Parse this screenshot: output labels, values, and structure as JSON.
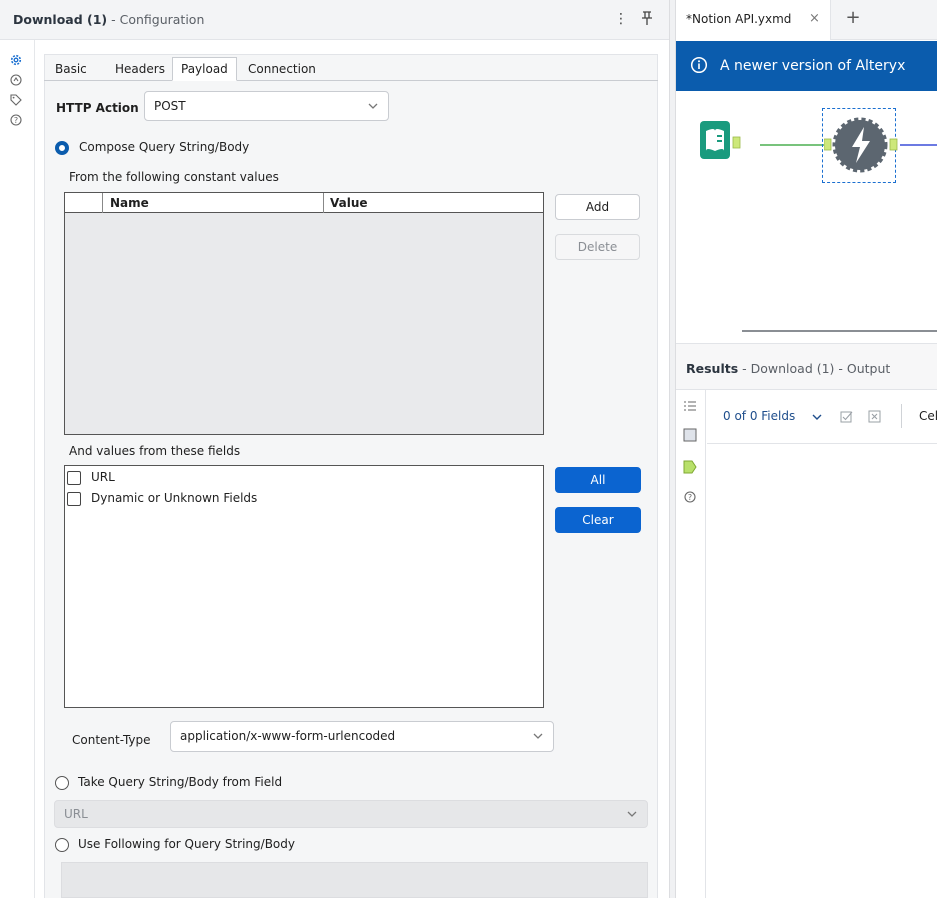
{
  "config_panel": {
    "title_bold": "Download (1)",
    "title_rest": " - Configuration",
    "tabs": [
      {
        "label": "Basic",
        "active": false
      },
      {
        "label": "Headers",
        "active": false
      },
      {
        "label": "Payload",
        "active": true
      },
      {
        "label": "Connection",
        "active": false
      }
    ],
    "http_action_label": "HTTP Action",
    "http_action_value": "POST",
    "compose_option_label": "Compose Query String/Body",
    "constant_values_label": "From the following constant values",
    "constant_grid": {
      "columns": [
        "Name",
        "Value"
      ],
      "rows": []
    },
    "add_button": "Add",
    "delete_button": "Delete",
    "fields_label": "And values from these fields",
    "fields": [
      {
        "label": "URL",
        "checked": false
      },
      {
        "label": "Dynamic or Unknown Fields",
        "checked": false
      }
    ],
    "all_button": "All",
    "clear_button": "Clear",
    "content_type_label": "Content-Type",
    "content_type_value": "application/x-www-form-urlencoded",
    "take_from_field_label": "Take Query String/Body from Field",
    "take_from_field_value": "URL",
    "use_following_label": "Use Following for Query String/Body"
  },
  "workspace": {
    "file_tab_label": "*Notion API.yxmd",
    "file_tab_close": "×",
    "new_tab": "+",
    "banner_text": "A newer version of Alteryx",
    "colors": {
      "banner": "#0b5cad",
      "accent_blue": "#0b64d0",
      "connector_green": "#4caf50",
      "connector_blue": "#3b4fd8"
    }
  },
  "results": {
    "title_bold": "Results",
    "title_rest": " - Download (1) - Output",
    "fields_count": "0 of 0 Fields",
    "cell_label": "Cel"
  }
}
